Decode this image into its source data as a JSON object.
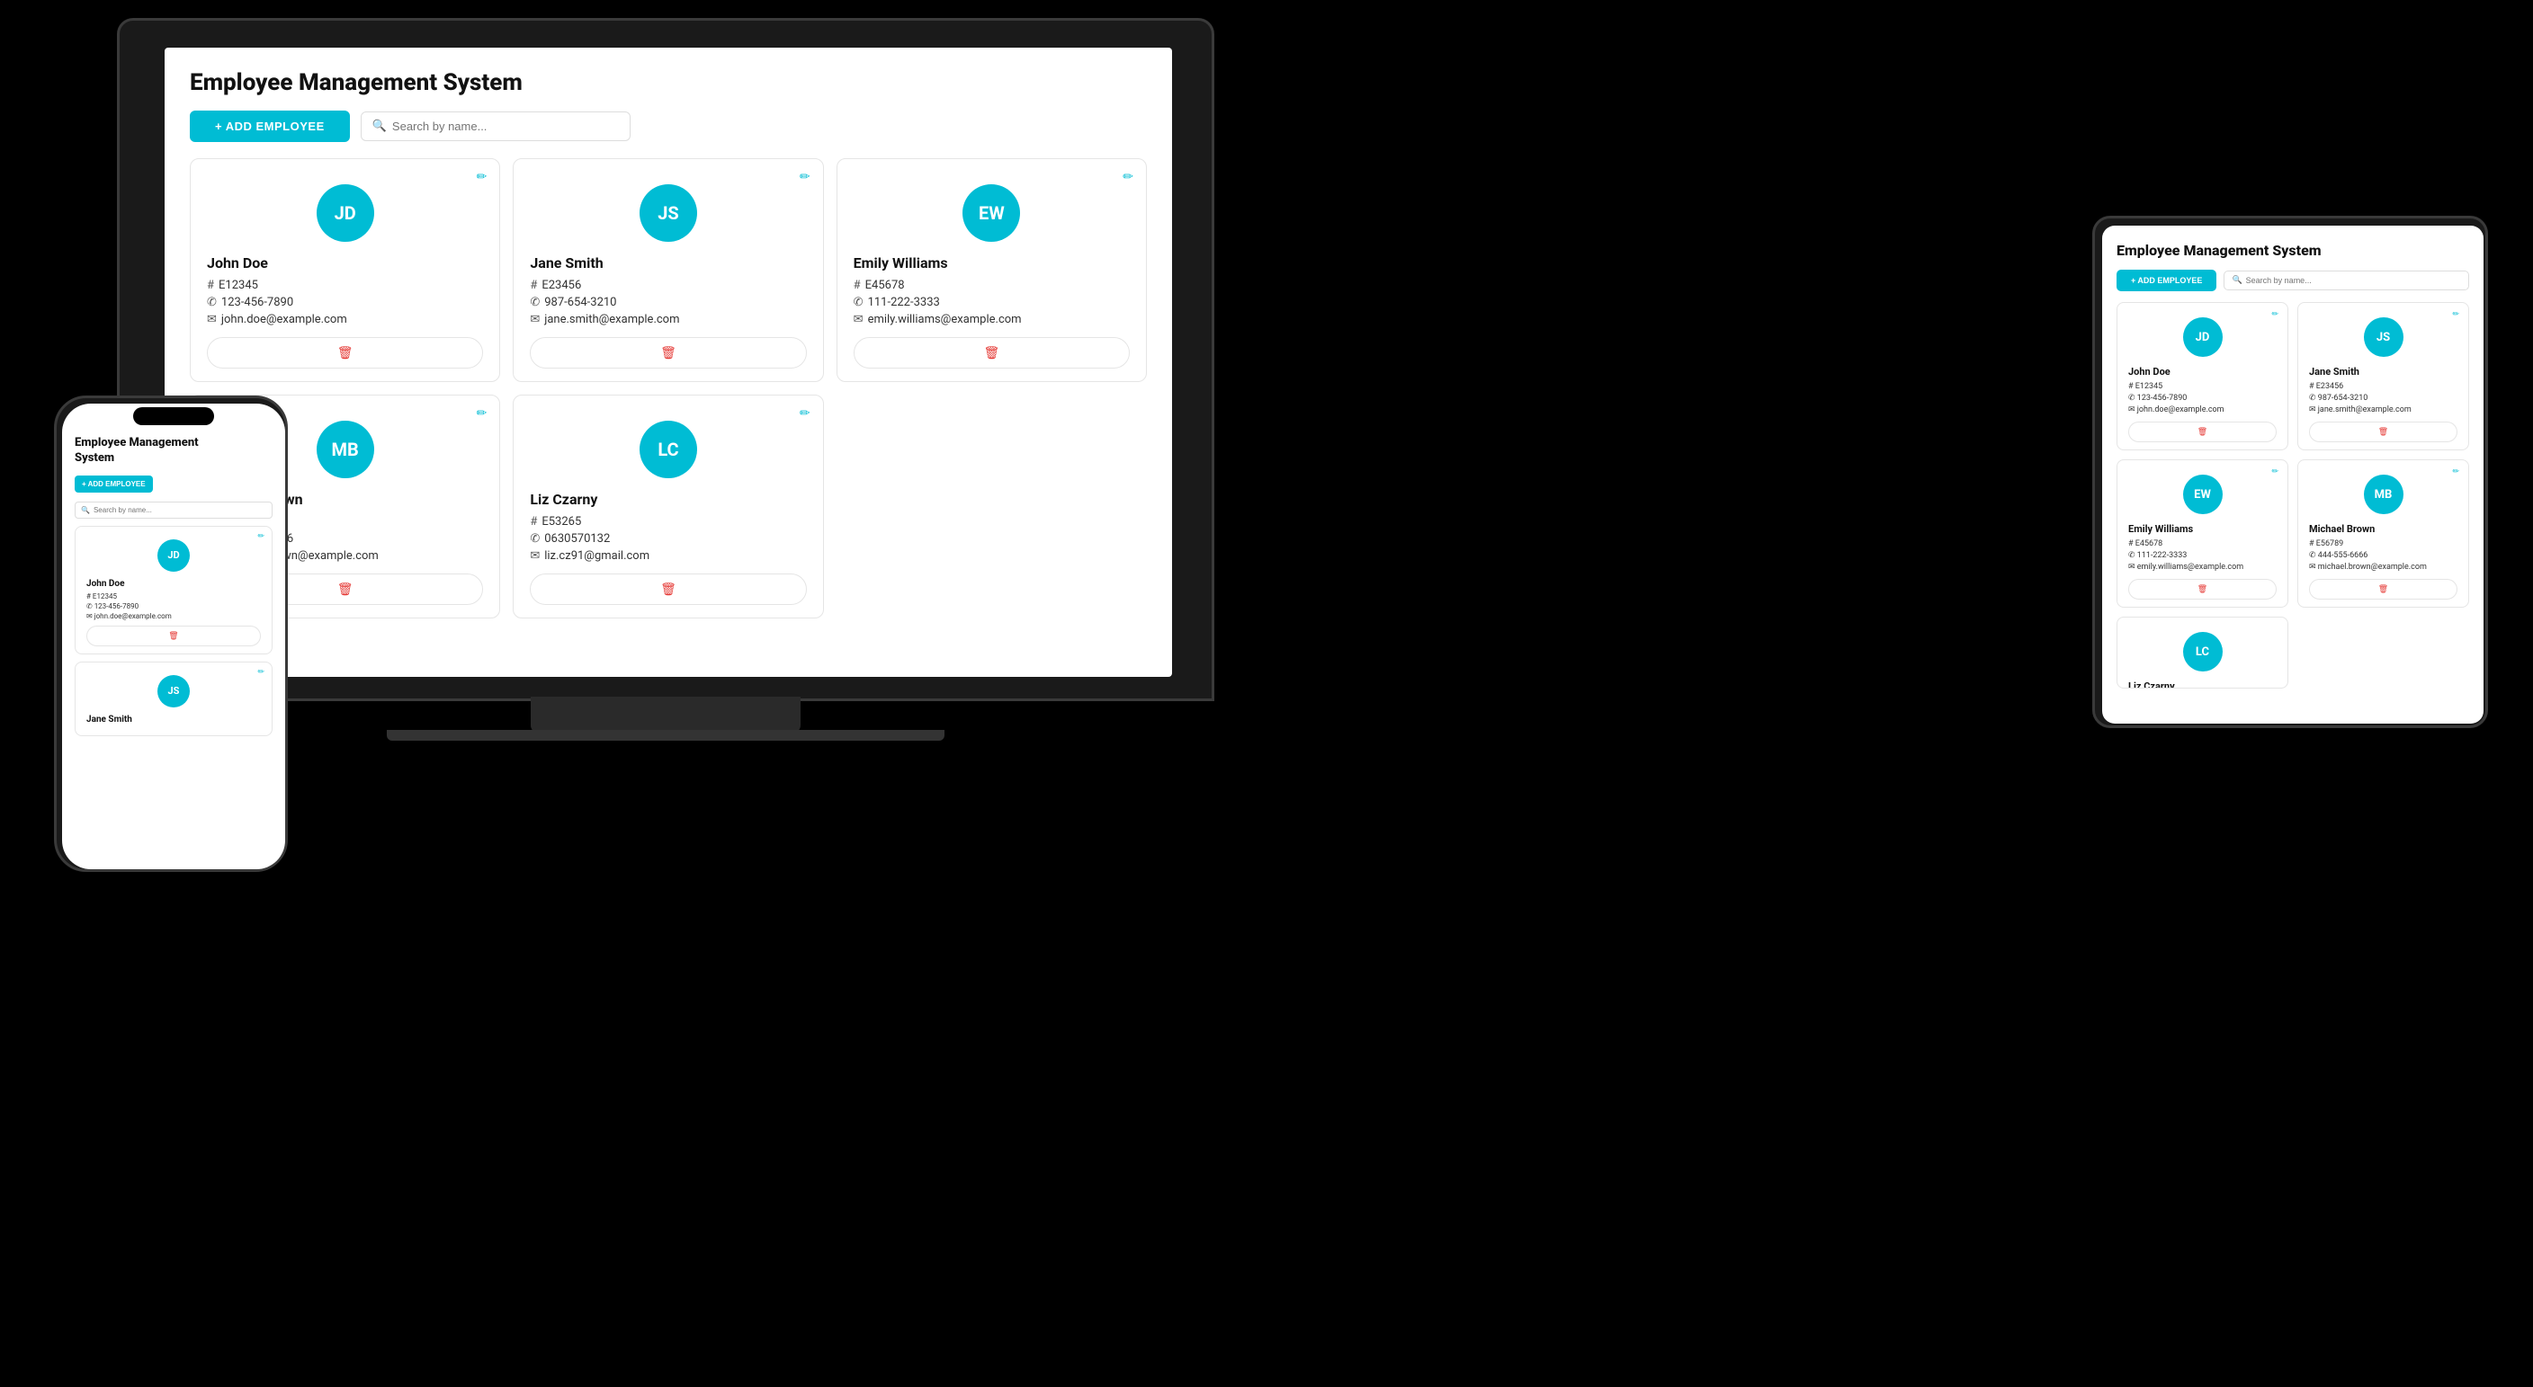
{
  "app": {
    "title": "Employee Management System",
    "add_button": "+ ADD EMPLOYEE",
    "search_placeholder": "Search by name..."
  },
  "employees": [
    {
      "initials": "JD",
      "name": "John Doe",
      "id": "E12345",
      "phone": "123-456-7890",
      "email": "john.doe@example.com"
    },
    {
      "initials": "JS",
      "name": "Jane Smith",
      "id": "E23456",
      "phone": "987-654-3210",
      "email": "jane.smith@example.com"
    },
    {
      "initials": "EW",
      "name": "Emily Williams",
      "id": "E45678",
      "phone": "111-222-3333",
      "email": "emily.williams@example.com"
    },
    {
      "initials": "MB",
      "name": "Michael Brown",
      "id": "E56789",
      "phone": "444-555-6666",
      "email": "michael.brown@example.com"
    },
    {
      "initials": "LC",
      "name": "Liz Czarny",
      "id": "E53265",
      "phone": "0630570132",
      "email": "liz.cz91@gmail.com"
    }
  ],
  "icons": {
    "edit": "✏",
    "id": "#",
    "phone": "✆",
    "email": "✉",
    "delete": "🗑",
    "search": "🔍"
  }
}
